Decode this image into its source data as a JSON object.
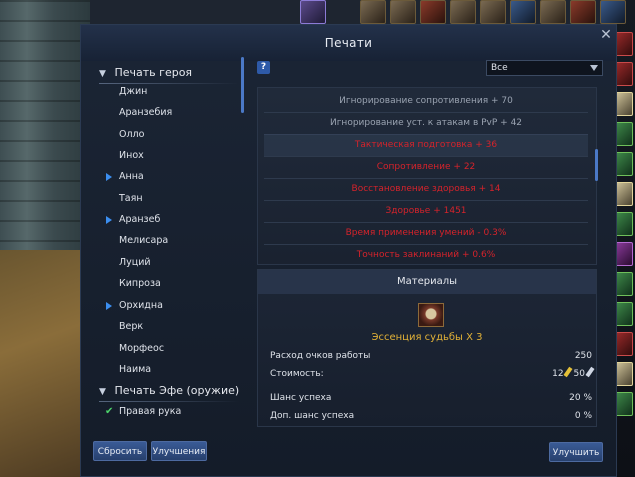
{
  "window": {
    "title": "Печати"
  },
  "tree": {
    "category1": "Печать героя",
    "heroes": [
      "Джин",
      "Аранзебия",
      "Олло",
      "Инох",
      "Анна",
      "Таян",
      "Аранзеб",
      "Мелисара",
      "Луций",
      "Кипроза",
      "Орхидна",
      "Верк",
      "Морфеос",
      "Наима"
    ],
    "category2": "Печать Эфе (оружие)",
    "sub_item": "Правая рука"
  },
  "filter": {
    "selected": "Все"
  },
  "stats": [
    {
      "text": "Игнорирование сопротивления + 70",
      "color": "white"
    },
    {
      "text": "Игнорирование уст. к атакам в PvP + 42",
      "color": "white"
    },
    {
      "text": "Тактическая подготовка + 36",
      "color": "red"
    },
    {
      "text": "Сопротивление + 22",
      "color": "red"
    },
    {
      "text": "Восстановление здоровья + 14",
      "color": "red"
    },
    {
      "text": "Здоровье + 1451",
      "color": "red"
    },
    {
      "text": "Время применения умений - 0.3%",
      "color": "red"
    },
    {
      "text": "Точность заклинаний + 0.6%",
      "color": "red"
    }
  ],
  "materials": {
    "header": "Материалы",
    "item_name": "Эссенция судьбы X 3",
    "work_cost_label": "Расход очков работы",
    "work_cost_value": "250",
    "cost_label": "Стоимость:",
    "cost_gold": "12",
    "cost_silver": "50",
    "success_label": "Шанс успеха",
    "success_value": "20 %",
    "bonus_label": "Доп. шанс успеха",
    "bonus_value": "0 %"
  },
  "buttons": {
    "reset": "Сбросить",
    "upgrades": "Улучшения",
    "improve": "Улучшить"
  },
  "help": "?"
}
